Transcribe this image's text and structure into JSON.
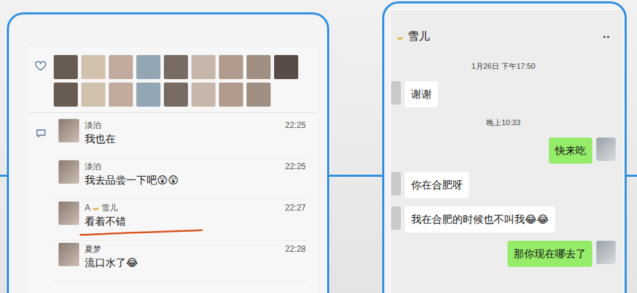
{
  "moments": {
    "comments": [
      {
        "name_prefix": "",
        "name": "淡泊",
        "badge": false,
        "time": "22:25",
        "text": "我也在",
        "underlined": false
      },
      {
        "name_prefix": "",
        "name": "淡泊",
        "badge": false,
        "time": "22:25",
        "text": "我去品尝一下吧😲😲",
        "underlined": false
      },
      {
        "name_prefix": "A",
        "name": "雪儿",
        "badge": true,
        "time": "22:27",
        "text": "看着不错",
        "underlined": true
      },
      {
        "name_prefix": "",
        "name": "夏梦",
        "badge": false,
        "time": "22:28",
        "text": "流口水了😂",
        "underlined": false
      }
    ]
  },
  "chat": {
    "title": "雪儿",
    "title_badge": true,
    "menu": "··",
    "messages": [
      {
        "kind": "time",
        "text": "1月26日 下午17:50"
      },
      {
        "kind": "received",
        "text": "谢谢"
      },
      {
        "kind": "time",
        "text": "晚上10:33"
      },
      {
        "kind": "sent",
        "text": "快来吃"
      },
      {
        "kind": "received",
        "text": "你在合肥呀"
      },
      {
        "kind": "received",
        "text": "我在合肥的时候也不叫我😂😂"
      },
      {
        "kind": "sent",
        "text": "那你现在哪去了"
      }
    ]
  }
}
